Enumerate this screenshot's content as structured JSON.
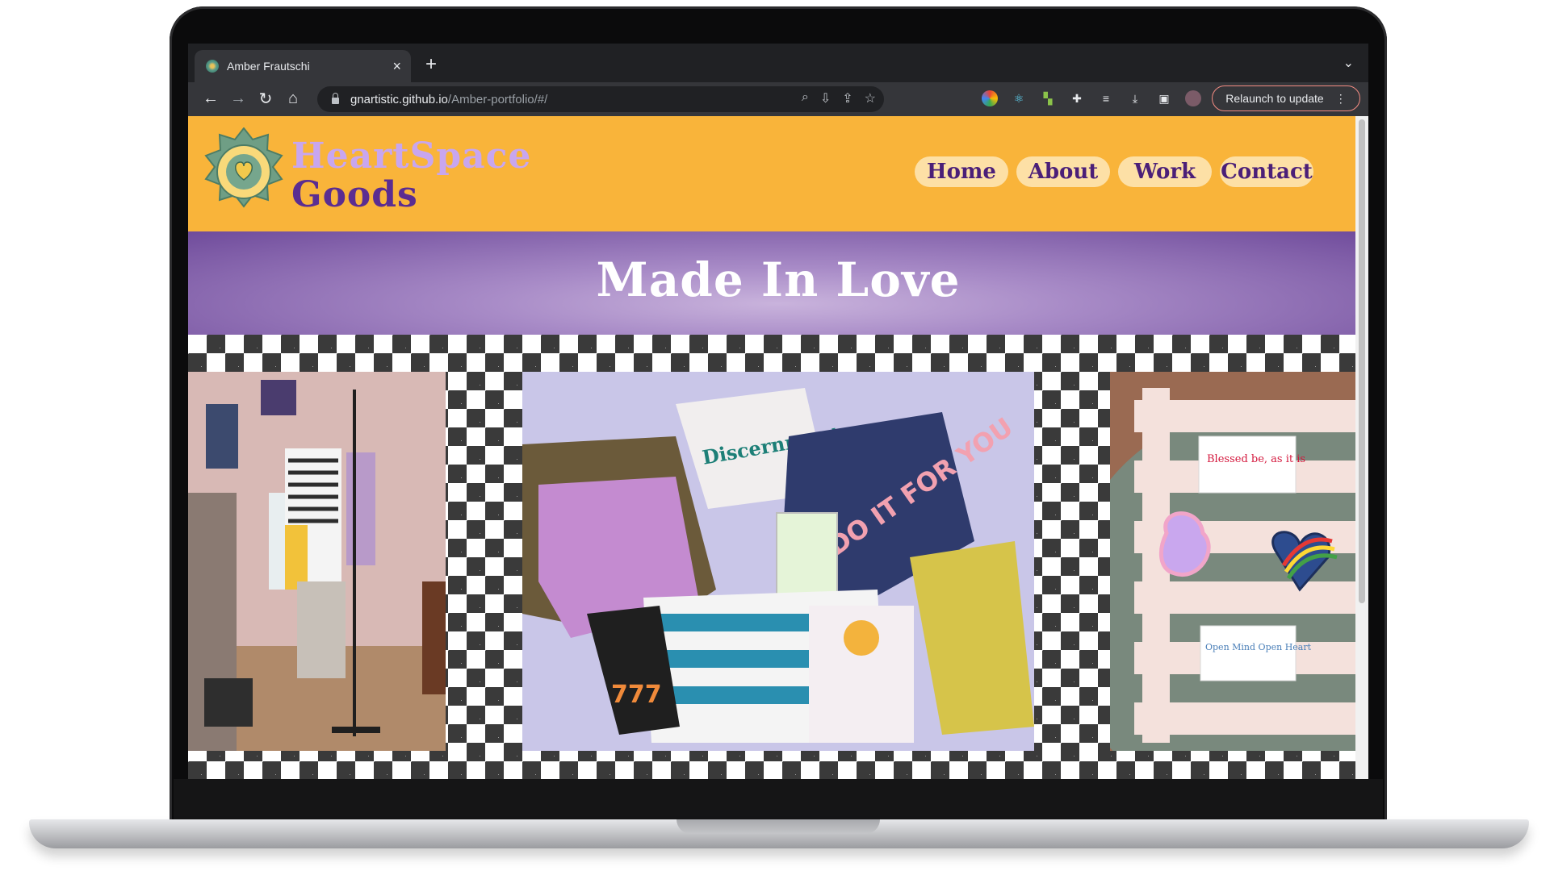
{
  "browser": {
    "tab_title": "Amber Frautschi",
    "tab_close": "×",
    "new_tab": "+",
    "url_host": "gnartistic.github.io",
    "url_path": "/Amber-portfolio/#/",
    "relaunch_label": "Relaunch to update",
    "icons": [
      "back-icon",
      "forward-icon",
      "reload-icon",
      "home-icon",
      "lock-icon",
      "zoom-icon",
      "install-icon",
      "share-icon",
      "star-icon",
      "extension-icon",
      "download-icon",
      "sidepanel-icon",
      "profile-icon",
      "menu-icon"
    ]
  },
  "site": {
    "brand_line1": "HeartSpace",
    "brand_line2": "Goods",
    "logo_ring_text": "HEARTSPACE GOODS",
    "nav": [
      "Home",
      "About",
      "Work",
      "Contact"
    ],
    "hero_title": "Made In Love",
    "colors": {
      "header": "#f9b43a",
      "nav_pill": "#fde0a6",
      "purple": "#5b2d91",
      "hero": "#a88bc7",
      "checker": "#3a3a3a"
    }
  },
  "gallery": {
    "photos": [
      {
        "name": "clothing-rack-photo"
      },
      {
        "name": "clothing-flatlay-photo",
        "shirt_texts": [
          "Discernment",
          "DO IT FOR YOU",
          "777"
        ]
      },
      {
        "name": "embroidered-patches-photo",
        "patch_texts": [
          "Blessed be, as it is",
          "Open Mind Open Heart"
        ]
      }
    ]
  }
}
